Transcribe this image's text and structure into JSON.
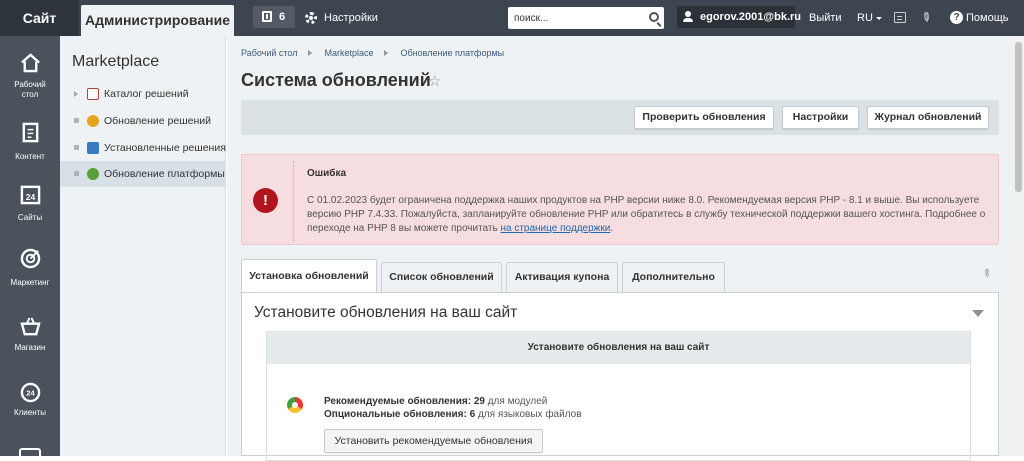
{
  "topbar": {
    "site": "Сайт",
    "admin": "Администрирование",
    "notifications_count": "6",
    "settings": "Настройки",
    "search_placeholder": "поиск...",
    "user": "egorov.2001@bk.ru",
    "logout": "Выйти",
    "lang": "RU",
    "help": "Помощь"
  },
  "leftnav": [
    {
      "label1": "Рабочий",
      "label2": "стол",
      "icon": "home-icon"
    },
    {
      "label1": "Контент",
      "label2": "",
      "icon": "document-icon"
    },
    {
      "label1": "Сайты",
      "label2": "",
      "icon": "calendar-24-icon"
    },
    {
      "label1": "Маркетинг",
      "label2": "",
      "icon": "target-icon"
    },
    {
      "label1": "Магазин",
      "label2": "",
      "icon": "basket-icon"
    },
    {
      "label1": "Клиенты",
      "label2": "",
      "icon": "clients-24-icon"
    }
  ],
  "sidebar": {
    "title": "Marketplace",
    "items": [
      {
        "label": "Каталог решений",
        "icon": "catalog-icon"
      },
      {
        "label": "Обновление решений",
        "icon": "update-solutions-icon"
      },
      {
        "label": "Установленные решения",
        "icon": "installed-solutions-icon"
      },
      {
        "label": "Обновление платформы",
        "icon": "platform-update-icon"
      }
    ]
  },
  "breadcrumbs": [
    "Рабочий стол",
    "Marketplace",
    "Обновление платформы"
  ],
  "page_title": "Система обновлений",
  "toolbar": {
    "check": "Проверить обновления",
    "settings": "Настройки",
    "log": "Журнал обновлений"
  },
  "error": {
    "title": "Ошибка",
    "text": "С 01.02.2023 будет ограничена поддержка наших продуктов на PHP версии ниже 8.0. Рекомендуемая версия PHP - 8.1 и выше. Вы используете версию PHP 7.4.33. Пожалуйста, запланируйте обновление PHP или обратитесь в службу технической поддержки вашего хостинга. Подробнее о переходе на PHP 8 вы можете прочитать ",
    "link": "на странице поддержки",
    "end": "."
  },
  "tabs": [
    "Установка обновлений",
    "Список обновлений",
    "Активация купона",
    "Дополнительно"
  ],
  "panel": {
    "title": "Установите обновления на ваш сайт",
    "inner_title": "Установите обновления на ваш сайт",
    "recommended_label": "Рекомендуемые обновления:",
    "recommended_count": "29",
    "recommended_suffix": "для модулей",
    "optional_label": "Опциональные обновления:",
    "optional_count": "6",
    "optional_suffix": "для языковых файлов",
    "install_button": "Установить рекомендуемые обновления"
  }
}
